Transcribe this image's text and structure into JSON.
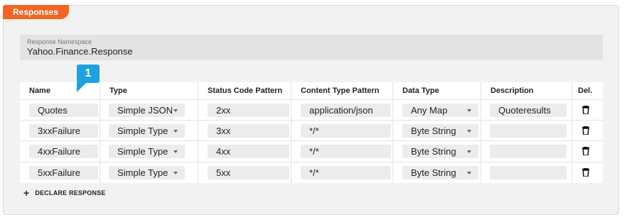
{
  "section": {
    "title": "Responses"
  },
  "namespace": {
    "label": "Response Namespace",
    "value": "Yahoo.Finance.Response"
  },
  "badge": {
    "number": "1",
    "color": "#1da1e1"
  },
  "colors": {
    "accent": "#f26522"
  },
  "table": {
    "headers": {
      "name": "Name",
      "type": "Type",
      "status": "Status Code Pattern",
      "content": "Content Type Pattern",
      "datatype": "Data Type",
      "description": "Description",
      "del": "Del."
    },
    "rows": [
      {
        "name": "Quotes",
        "type": "Simple JSON",
        "status": "2xx",
        "content": "application/json",
        "datatype": "Any Map",
        "description": "Quoteresults"
      },
      {
        "name": "3xxFailure",
        "type": "Simple Type",
        "status": "3xx",
        "content": "*/*",
        "datatype": "Byte String",
        "description": ""
      },
      {
        "name": "4xxFailure",
        "type": "Simple Type",
        "status": "4xx",
        "content": "*/*",
        "datatype": "Byte String",
        "description": ""
      },
      {
        "name": "5xxFailure",
        "type": "Simple Type",
        "status": "5xx",
        "content": "*/*",
        "datatype": "Byte String",
        "description": ""
      }
    ]
  },
  "actions": {
    "declare_response": "DECLARE RESPONSE",
    "add_icon": "plus-icon",
    "delete_icon": "trash-icon"
  }
}
